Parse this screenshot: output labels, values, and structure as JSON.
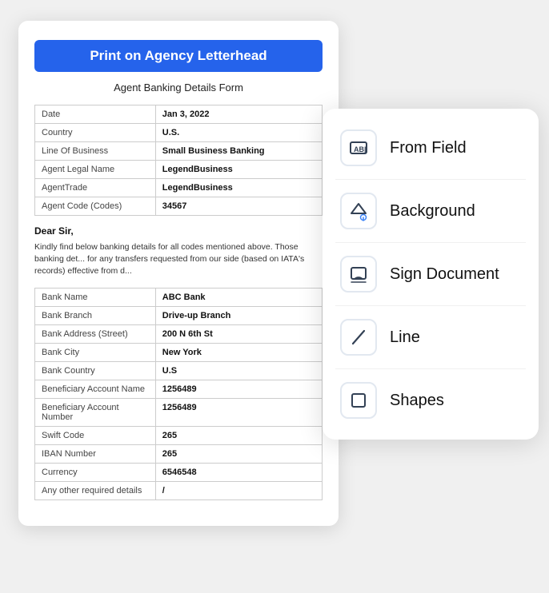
{
  "document": {
    "title": "Print on Agency Letterhead",
    "subtitle": "Agent Banking Details Form",
    "top_table": [
      [
        "Date",
        "Jan 3, 2022"
      ],
      [
        "Country",
        "U.S."
      ],
      [
        "Line Of Business",
        "Small Business Banking"
      ],
      [
        "Agent Legal Name",
        "LegendBusiness"
      ],
      [
        "AgentTrade",
        "LegendBusiness"
      ],
      [
        "Agent Code (Codes)",
        "34567"
      ]
    ],
    "salutation": "Dear Sir,",
    "body_text": "Kindly find below banking details for all codes mentioned above. Those banking det... for any transfers requested from our side (based on IATA's records) effective from d...",
    "bottom_table": [
      [
        "Bank Name",
        "ABC Bank"
      ],
      [
        "Bank Branch",
        "Drive-up Branch"
      ],
      [
        "Bank Address (Street)",
        "200 N 6th St"
      ],
      [
        "Bank City",
        "New York"
      ],
      [
        "Bank Country",
        "U.S"
      ],
      [
        "Beneficiary Account Name",
        "1256489"
      ],
      [
        "Beneficiary Account Number",
        "1256489"
      ],
      [
        "Swift Code",
        "265"
      ],
      [
        "IBAN Number",
        "265"
      ],
      [
        "Currency",
        "6546548"
      ],
      [
        "Any other required details",
        "/"
      ]
    ]
  },
  "tools": {
    "items": [
      {
        "id": "from-field",
        "label": "From Field"
      },
      {
        "id": "background",
        "label": "Background"
      },
      {
        "id": "sign-document",
        "label": "Sign Document"
      },
      {
        "id": "line",
        "label": "Line"
      },
      {
        "id": "shapes",
        "label": "Shapes"
      }
    ]
  }
}
